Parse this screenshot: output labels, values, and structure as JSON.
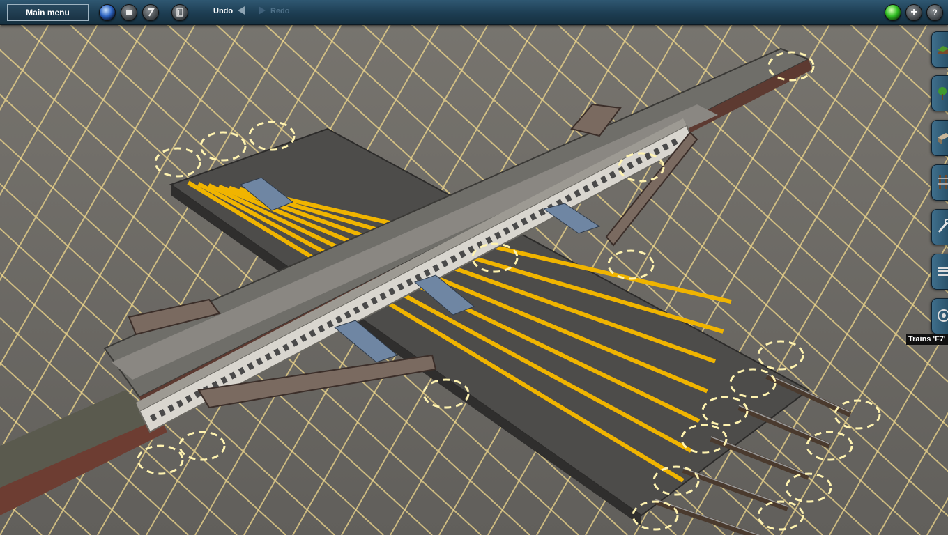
{
  "toolbar": {
    "main_menu_label": "Main menu",
    "undo_label": "Undo",
    "redo_label": "Redo",
    "buttons": [
      {
        "name": "camera-ball-icon"
      },
      {
        "name": "stop-icon"
      },
      {
        "name": "weather-icon"
      },
      {
        "name": "trash-icon"
      }
    ],
    "right_buttons": [
      {
        "name": "status-green-icon"
      },
      {
        "name": "add-icon"
      },
      {
        "name": "help-icon",
        "label": "?"
      }
    ]
  },
  "side_tabs": [
    {
      "name": "terrain-tab-icon"
    },
    {
      "name": "trees-tab-icon"
    },
    {
      "name": "objects-tab-icon"
    },
    {
      "name": "track-tab-icon"
    },
    {
      "name": "tools-tab-icon"
    },
    {
      "name": "layers-tab-icon"
    },
    {
      "name": "trains-tab-icon"
    }
  ],
  "tooltip": "Trains 'F7'",
  "colors": {
    "grid_line": "#f0d88c",
    "ground": "#6c6a66",
    "platform_stripe": "#f0b400",
    "toolbar": "#1d3d52"
  }
}
